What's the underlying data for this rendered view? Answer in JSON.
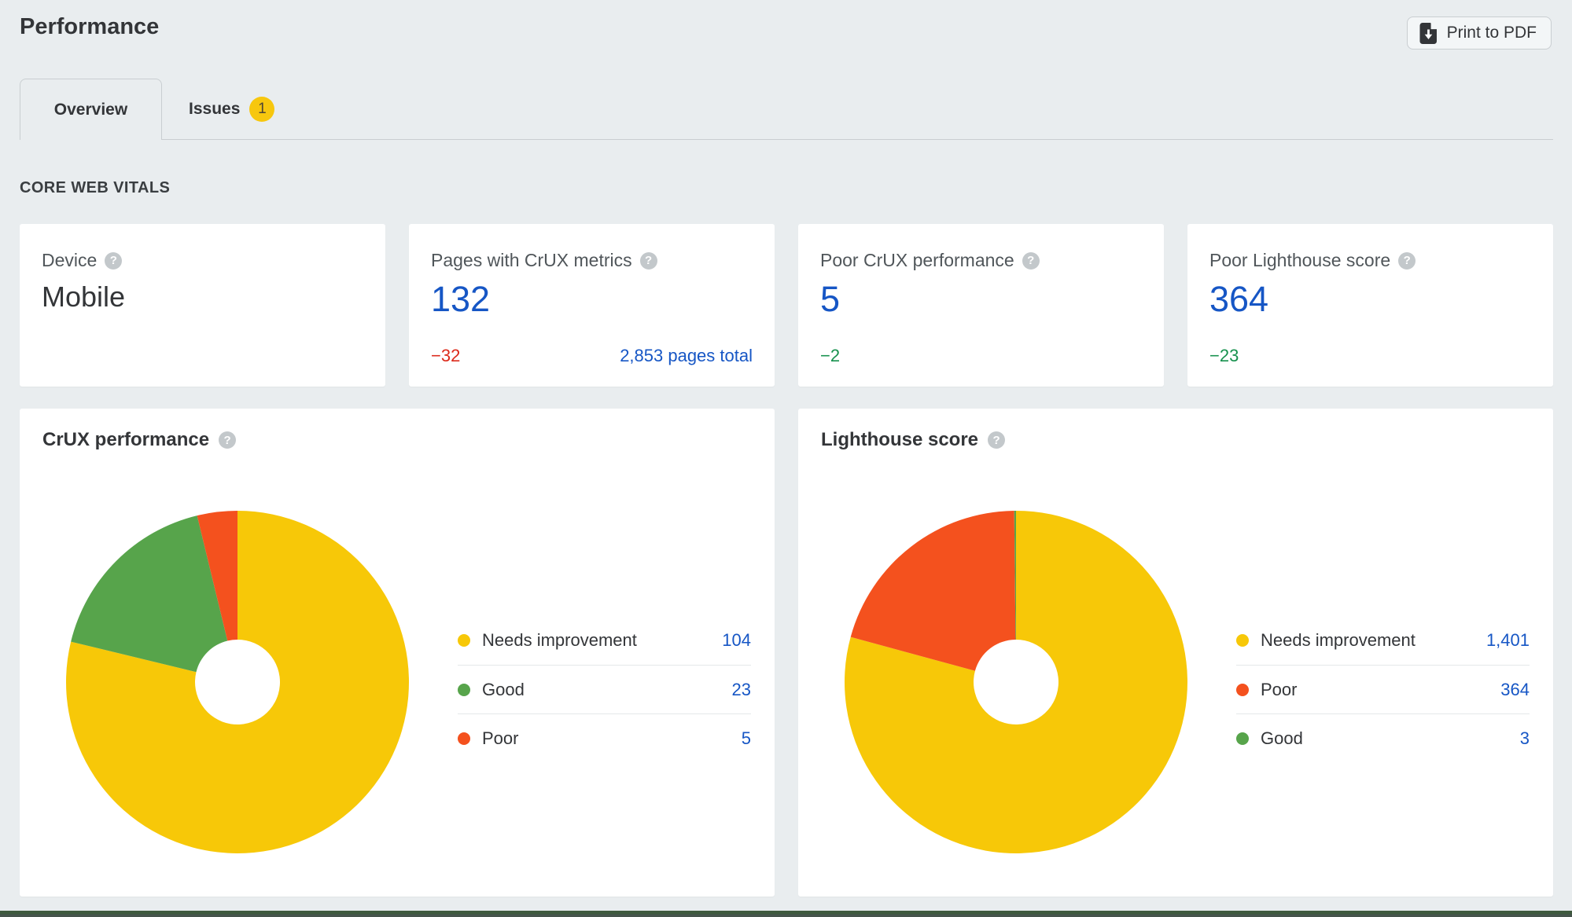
{
  "header": {
    "title": "Performance",
    "print_button": "Print to PDF"
  },
  "tabs": [
    {
      "label": "Overview",
      "active": true
    },
    {
      "label": "Issues",
      "active": false,
      "badge": "1"
    }
  ],
  "section_label": "CORE WEB VITALS",
  "stat_cards": [
    {
      "label": "Device",
      "value": "Mobile"
    },
    {
      "label": "Pages with CrUX metrics",
      "value": "132",
      "delta": "−32",
      "delta_color": "red",
      "total_link": "2,853 pages total"
    },
    {
      "label": "Poor CrUX performance",
      "value": "5",
      "delta": "−2",
      "delta_color": "green"
    },
    {
      "label": "Poor Lighthouse score",
      "value": "364",
      "delta": "−23",
      "delta_color": "green"
    }
  ],
  "chart_data": [
    {
      "type": "pie",
      "donut": true,
      "title": "CrUX performance",
      "labels": [
        "Needs improvement",
        "Good",
        "Poor"
      ],
      "values": [
        104,
        23,
        5
      ],
      "display_values": [
        "104",
        "23",
        "5"
      ],
      "colors": [
        "#F7C808",
        "#57A44B",
        "#F4511E"
      ],
      "start_angle_deg": 0,
      "direction": "clockwise",
      "legend_position": "right"
    },
    {
      "type": "pie",
      "donut": true,
      "title": "Lighthouse score",
      "labels": [
        "Needs improvement",
        "Poor",
        "Good"
      ],
      "values": [
        1401,
        364,
        3
      ],
      "display_values": [
        "1,401",
        "364",
        "3"
      ],
      "colors": [
        "#F7C808",
        "#F4511E",
        "#57A44B"
      ],
      "start_angle_deg": 0,
      "direction": "clockwise",
      "legend_position": "right"
    }
  ],
  "icons": {
    "help_glyph": "?"
  },
  "colors": {
    "page-bg": "#E9EDEF",
    "card-bg": "#FFFFFF",
    "border": "#C9CED1",
    "divider": "#E5E8EA",
    "text-dark": "#333538",
    "text-gray": "#50565A",
    "accent-blue": "#1656C5",
    "delta-red": "#DC2A1B",
    "delta-green": "#17914E",
    "badge-yellow": "#F7C70E",
    "help-gray": "#C3C8CB"
  }
}
